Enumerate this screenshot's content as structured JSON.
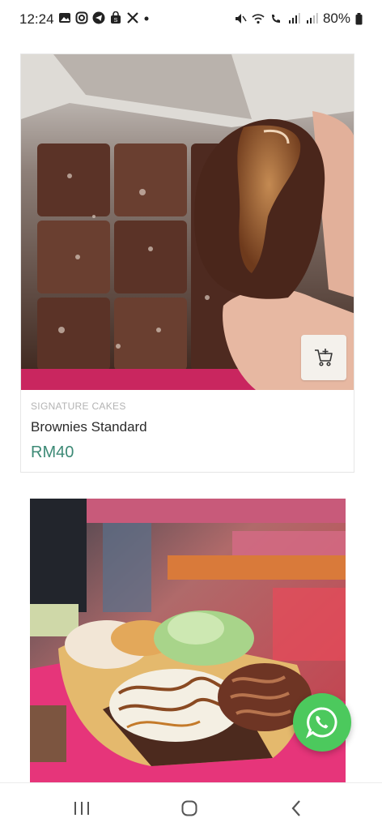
{
  "status_bar": {
    "time": "12:24",
    "left_icons": [
      "gallery-icon",
      "instagram-icon",
      "telegram-icon",
      "shop-bag-icon",
      "x-icon",
      "dot-icon"
    ],
    "right_icons": [
      "mute-icon",
      "wifi-icon",
      "wifi-call-icon",
      "signal-icon",
      "signal-icon"
    ],
    "battery": "80%"
  },
  "products": [
    {
      "category": "SIGNATURE CAKES",
      "name": "Brownies Standard",
      "price": "RM40",
      "image": "brownies-photo",
      "cart_icon": "add-to-cart-icon"
    },
    {
      "image": "cake-platter-photo"
    }
  ],
  "floating": {
    "icon": "whatsapp-icon"
  },
  "nav": {
    "icons": [
      "recent-apps-icon",
      "home-icon",
      "back-icon"
    ]
  },
  "colors": {
    "price": "#3d8a76",
    "whatsapp": "#4cc95d",
    "category": "#b3b3b3"
  }
}
